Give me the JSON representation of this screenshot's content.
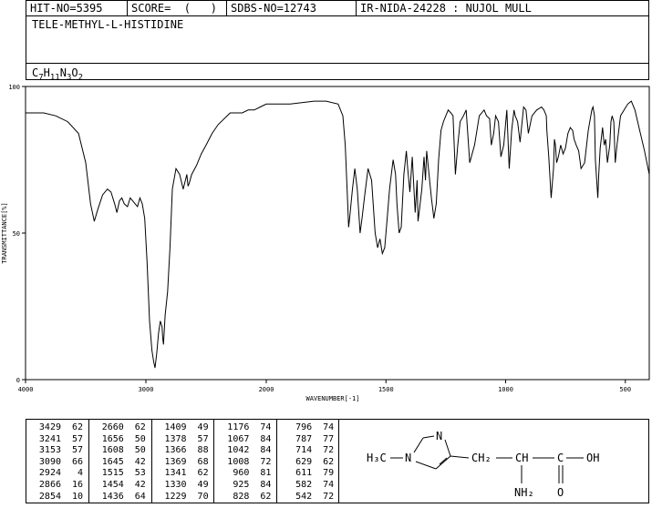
{
  "header": {
    "hit_no": "HIT-NO=5395",
    "score": "SCORE=  (   )",
    "sdbs_no": "SDBS-NO=12743",
    "ir_nida": "IR-NIDA-24228 : NUJOL MULL",
    "compound_name": "TELE-METHYL-L-HISTIDINE",
    "formula": {
      "c": "C",
      "c_n": "7",
      "h": "H",
      "h_n": "11",
      "n": "N",
      "n_n": "3",
      "o": "O",
      "o_n": "2"
    }
  },
  "chart_data": {
    "type": "line",
    "xlabel": "WAVENUMBER[-1]",
    "ylabel": "TRANSMITTANCE[%]",
    "xlim": [
      4000,
      400
    ],
    "ylim": [
      0,
      100
    ],
    "x_ticks": [
      "4000",
      "3000",
      "2000",
      "1500",
      "1000",
      "500"
    ],
    "y_ticks": [
      "100",
      "50",
      "0"
    ],
    "series": [
      {
        "x": [
          4000,
          3950,
          3850,
          3750,
          3650,
          3560,
          3500,
          3460,
          3429,
          3400,
          3360,
          3320,
          3290,
          3260,
          3241,
          3220,
          3200,
          3180,
          3153,
          3130,
          3110,
          3090,
          3070,
          3050,
          3030,
          3010,
          2990,
          2970,
          2950,
          2935,
          2924,
          2910,
          2895,
          2880,
          2866,
          2860,
          2854,
          2840,
          2820,
          2800,
          2780,
          2750,
          2720,
          2690,
          2660,
          2650,
          2640,
          2620,
          2580,
          2540,
          2500,
          2450,
          2400,
          2300,
          2200,
          2150,
          2100,
          2050,
          2000,
          1900,
          1800,
          1750,
          1700,
          1680,
          1670,
          1660,
          1656,
          1652,
          1640,
          1630,
          1620,
          1608,
          1600,
          1590,
          1575,
          1560,
          1545,
          1535,
          1525,
          1515,
          1505,
          1495,
          1485,
          1470,
          1460,
          1454,
          1445,
          1436,
          1425,
          1415,
          1409,
          1400,
          1390,
          1378,
          1370,
          1366,
          1360,
          1350,
          1341,
          1335,
          1330,
          1320,
          1310,
          1300,
          1290,
          1280,
          1270,
          1260,
          1250,
          1240,
          1229,
          1220,
          1210,
          1200,
          1190,
          1176,
          1165,
          1150,
          1130,
          1110,
          1090,
          1080,
          1067,
          1060,
          1050,
          1042,
          1030,
          1020,
          1008,
          995,
          985,
          975,
          965,
          960,
          950,
          940,
          935,
          925,
          915,
          905,
          890,
          870,
          850,
          840,
          830,
          828,
          820,
          810,
          800,
          796,
          792,
          787,
          780,
          770,
          760,
          750,
          740,
          730,
          720,
          714,
          705,
          695,
          685,
          670,
          655,
          640,
          635,
          629,
          625,
          615,
          611,
          605,
          595,
          588,
          582,
          575,
          565,
          560,
          555,
          548,
          542,
          535,
          520,
          505,
          490,
          475,
          460,
          440,
          420,
          405,
          400
        ],
        "y": [
          91,
          91,
          91,
          90,
          88,
          84,
          74,
          60,
          54,
          58,
          63,
          65,
          64,
          60,
          57,
          61,
          62,
          60,
          59,
          62,
          61,
          60,
          59,
          62,
          60,
          55,
          40,
          20,
          10,
          6,
          4,
          9,
          16,
          20,
          18,
          14,
          12,
          22,
          30,
          45,
          65,
          72,
          70,
          65,
          70,
          66,
          67,
          70,
          73,
          77,
          80,
          84,
          87,
          91,
          91,
          92,
          92,
          93,
          94,
          94,
          95,
          95,
          94,
          90,
          80,
          60,
          52,
          55,
          65,
          72,
          65,
          50,
          55,
          62,
          72,
          68,
          50,
          45,
          48,
          43,
          45,
          55,
          65,
          75,
          70,
          60,
          50,
          52,
          70,
          78,
          72,
          64,
          76,
          57,
          68,
          54,
          58,
          65,
          76,
          68,
          78,
          70,
          62,
          55,
          60,
          75,
          85,
          88,
          90,
          92,
          91,
          90,
          70,
          80,
          88,
          90,
          92,
          74,
          80,
          90,
          92,
          90,
          89,
          80,
          84,
          90,
          88,
          76,
          80,
          92,
          72,
          85,
          92,
          90,
          88,
          81,
          85,
          93,
          92,
          84,
          90,
          92,
          93,
          92,
          90,
          85,
          76,
          62,
          72,
          82,
          80,
          74,
          76,
          80,
          77,
          79,
          84,
          86,
          85,
          82,
          80,
          78,
          72,
          74,
          85,
          92,
          93,
          90,
          75,
          62,
          70,
          79,
          86,
          80,
          82,
          74,
          80,
          88,
          90,
          88,
          74,
          80,
          90,
          92,
          94,
          95,
          92,
          85,
          78,
          72,
          70
        ]
      }
    ],
    "peak_table": [
      {
        "wavenumber": "3429",
        "transmittance": "62"
      },
      {
        "wavenumber": "3241",
        "transmittance": "57"
      },
      {
        "wavenumber": "3153",
        "transmittance": "57"
      },
      {
        "wavenumber": "3090",
        "transmittance": "66"
      },
      {
        "wavenumber": "2924",
        "transmittance": "4"
      },
      {
        "wavenumber": "2866",
        "transmittance": "16"
      },
      {
        "wavenumber": "2854",
        "transmittance": "10"
      },
      {
        "wavenumber": "2660",
        "transmittance": "62"
      },
      {
        "wavenumber": "1656",
        "transmittance": "50"
      },
      {
        "wavenumber": "1608",
        "transmittance": "50"
      },
      {
        "wavenumber": "1645",
        "transmittance": "42"
      },
      {
        "wavenumber": "1515",
        "transmittance": "53"
      },
      {
        "wavenumber": "1454",
        "transmittance": "42"
      },
      {
        "wavenumber": "1436",
        "transmittance": "64"
      },
      {
        "wavenumber": "1409",
        "transmittance": "49"
      },
      {
        "wavenumber": "1378",
        "transmittance": "57"
      },
      {
        "wavenumber": "1366",
        "transmittance": "88"
      },
      {
        "wavenumber": "1369",
        "transmittance": "68"
      },
      {
        "wavenumber": "1341",
        "transmittance": "62"
      },
      {
        "wavenumber": "1330",
        "transmittance": "49"
      },
      {
        "wavenumber": "1229",
        "transmittance": "70"
      },
      {
        "wavenumber": "1176",
        "transmittance": "74"
      },
      {
        "wavenumber": "1067",
        "transmittance": "84"
      },
      {
        "wavenumber": "1042",
        "transmittance": "84"
      },
      {
        "wavenumber": "1008",
        "transmittance": "72"
      },
      {
        "wavenumber": "960",
        "transmittance": "81"
      },
      {
        "wavenumber": "925",
        "transmittance": "84"
      },
      {
        "wavenumber": "828",
        "transmittance": "62"
      },
      {
        "wavenumber": "796",
        "transmittance": "74"
      },
      {
        "wavenumber": "787",
        "transmittance": "77"
      },
      {
        "wavenumber": "714",
        "transmittance": "72"
      },
      {
        "wavenumber": "629",
        "transmittance": "62"
      },
      {
        "wavenumber": "611",
        "transmittance": "79"
      },
      {
        "wavenumber": "582",
        "transmittance": "74"
      },
      {
        "wavenumber": "542",
        "transmittance": "72"
      }
    ]
  },
  "structure": {
    "h3c": "H₃C",
    "dash": "—",
    "n1": "N",
    "n2": "N",
    "ch2": "CH₂",
    "ch": "CH",
    "c": "C",
    "oh": "OH",
    "o": "O",
    "nh2": "NH₂"
  }
}
